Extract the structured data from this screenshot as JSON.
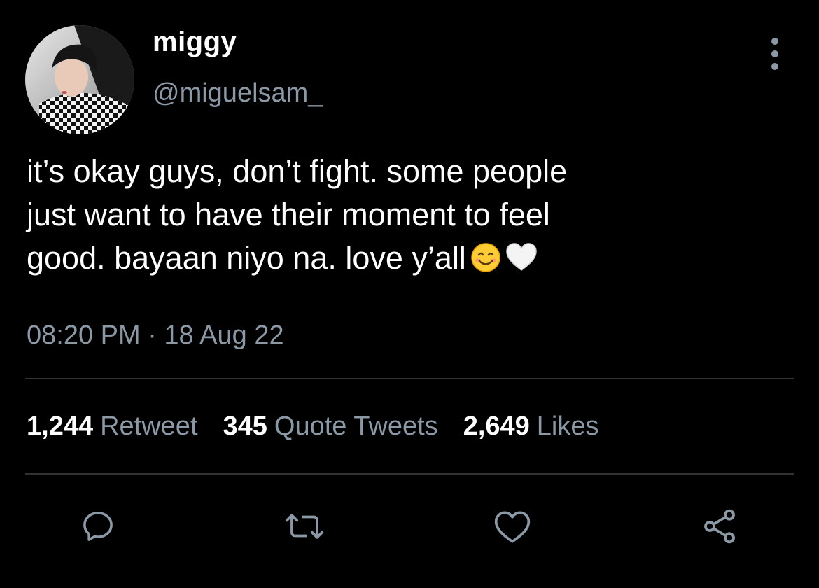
{
  "tweet": {
    "display_name": "miggy",
    "handle": "@miguelsam_",
    "text_lines": [
      "it’s okay guys, don’t fight. some people",
      "just want to have their moment to feel",
      "good. bayaan niyo na. love y’all"
    ],
    "emojis": [
      "smiling-face-emoji",
      "white-heart-emoji"
    ],
    "timestamp": "08:20 PM · 18 Aug 22"
  },
  "stats": {
    "retweets": {
      "count": "1,244",
      "label": "Retweet"
    },
    "quotes": {
      "count": "345",
      "label": "Quote Tweets"
    },
    "likes": {
      "count": "2,649",
      "label": "Likes"
    }
  },
  "actions": [
    "reply-icon",
    "retweet-icon",
    "like-icon",
    "share-icon"
  ],
  "colors": {
    "background": "#000000",
    "primary_text": "#ffffff",
    "secondary_text": "#8b98a5",
    "divider": "#2f3336"
  }
}
